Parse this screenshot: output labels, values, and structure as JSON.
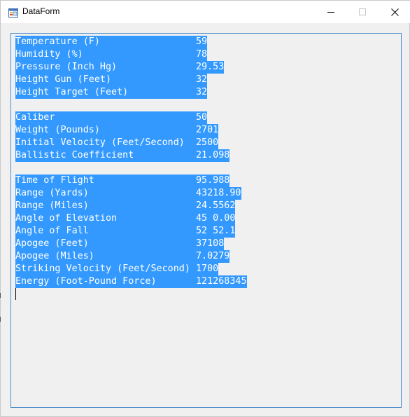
{
  "window": {
    "title": "DataForm"
  },
  "sections": [
    {
      "rows": [
        {
          "label": "Temperature (F)",
          "value": "59"
        },
        {
          "label": "Humidity (%)",
          "value": "78"
        },
        {
          "label": "Pressure (Inch Hg)",
          "value": "29.53"
        },
        {
          "label": "Height Gun (Feet)",
          "value": "32"
        },
        {
          "label": "Height Target (Feet)",
          "value": "32"
        }
      ]
    },
    {
      "rows": [
        {
          "label": "Caliber",
          "value": "50"
        },
        {
          "label": "Weight (Pounds)",
          "value": "2701"
        },
        {
          "label": "Initial Velocity (Feet/Second)",
          "value": "2500"
        },
        {
          "label": "Ballistic Coefficient",
          "value": "21.098"
        }
      ]
    },
    {
      "rows": [
        {
          "label": "Time of Flight",
          "value": "95.988"
        },
        {
          "label": "Range (Yards)",
          "value": "43218.90"
        },
        {
          "label": "Range (Miles)",
          "value": "24.5562"
        },
        {
          "label": "Angle of Elevation",
          "value": "45 0.00"
        },
        {
          "label": "Angle of Fall",
          "value": "52 52.1"
        },
        {
          "label": "Apogee (Feet)",
          "value": "37108"
        },
        {
          "label": "Apogee (Miles)",
          "value": "7.0279"
        },
        {
          "label": "Striking Velocity (Feet/Second)",
          "value": "1700"
        },
        {
          "label": "Energy (Foot-Pound Force)",
          "value": "121268345"
        }
      ]
    }
  ],
  "colors": {
    "selection": "#3399ff",
    "textbox_border": "#4a8bc9"
  },
  "icons": {
    "app": "form-icon",
    "minimize": "minimize-icon",
    "maximize": "maximize-icon",
    "close": "close-icon"
  }
}
